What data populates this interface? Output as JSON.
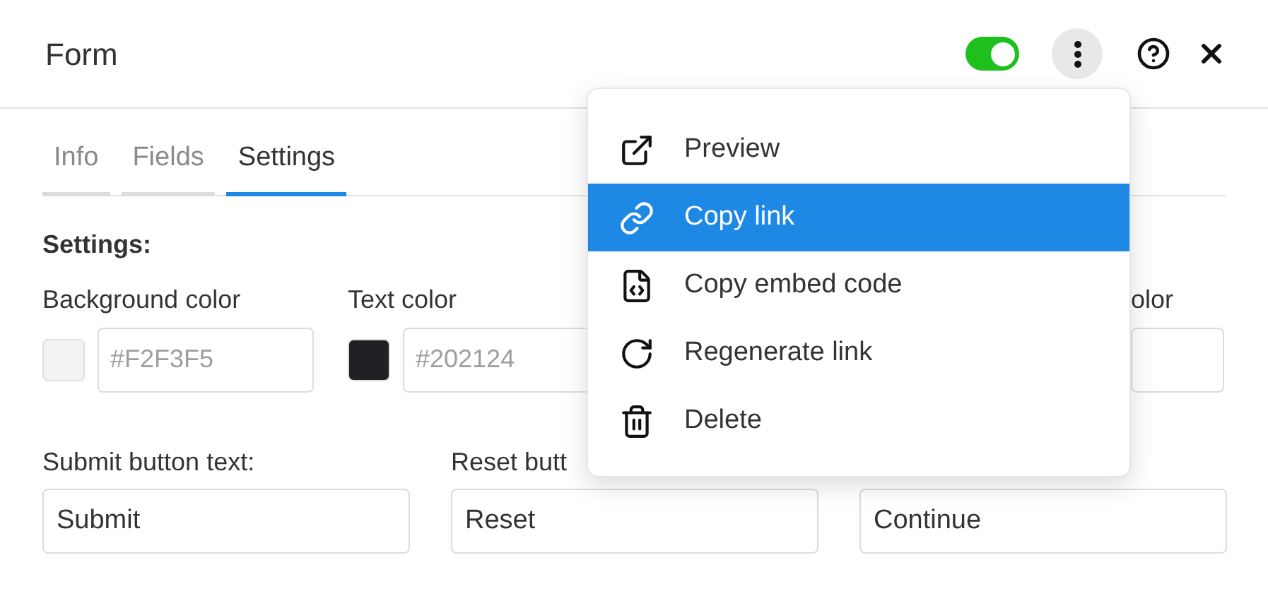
{
  "header": {
    "title": "Form",
    "toggle": {
      "on": true
    },
    "more_button": {
      "active": true
    }
  },
  "tabs": [
    {
      "label": "Info",
      "selected": false
    },
    {
      "label": "Fields",
      "selected": false
    },
    {
      "label": "Settings",
      "selected": true
    }
  ],
  "section_title": "Settings:",
  "color_settings": [
    {
      "label": "Background color",
      "color": "#f2f3f5",
      "placeholder": "#F2F3F5"
    },
    {
      "label": "Text color",
      "color": "#202124",
      "placeholder": "#202124"
    },
    {
      "label": "olor"
    }
  ],
  "button_texts": [
    {
      "label": "Submit button text:",
      "value": "Submit"
    },
    {
      "label": "Reset butt",
      "value": "Reset"
    },
    {
      "value": "Continue"
    }
  ],
  "menu": {
    "items": [
      {
        "kind": "preview",
        "label": "Preview",
        "selected": false
      },
      {
        "kind": "link",
        "label": "Copy link",
        "selected": true
      },
      {
        "kind": "embed",
        "label": "Copy embed code",
        "selected": false
      },
      {
        "kind": "regenerate",
        "label": "Regenerate link",
        "selected": false
      },
      {
        "kind": "delete",
        "label": "Delete",
        "selected": false
      }
    ]
  }
}
